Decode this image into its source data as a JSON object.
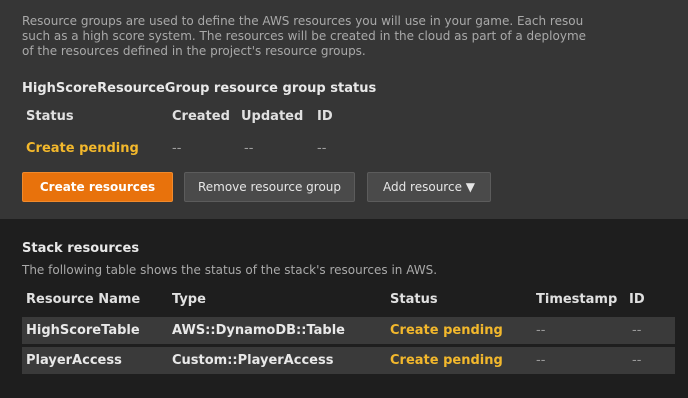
{
  "intro_lines": [
    "Resource groups are used to define the AWS resources you will use in your game. Each resou",
    "such as a high score system. The resources will be created in the cloud as part of a deployme",
    "of the resources defined in the project's resource groups."
  ],
  "group": {
    "title": "HighScoreResourceGroup resource group status",
    "headers": {
      "status": "Status",
      "created": "Created",
      "updated": "Updated",
      "id": "ID"
    },
    "values": {
      "status": "Create pending",
      "created": "--",
      "updated": "--",
      "id": "--"
    }
  },
  "buttons": {
    "create": "Create resources",
    "remove": "Remove resource group",
    "add": "Add resource ▼"
  },
  "stack": {
    "title": "Stack resources",
    "description": "The following table shows the status of the stack's resources in AWS.",
    "headers": {
      "name": "Resource Name",
      "type": "Type",
      "status": "Status",
      "timestamp": "Timestamp",
      "id": "ID"
    },
    "rows": [
      {
        "name": "HighScoreTable",
        "type": "AWS::DynamoDB::Table",
        "status": "Create pending",
        "timestamp": "--",
        "id": "--"
      },
      {
        "name": "PlayerAccess",
        "type": "Custom::PlayerAccess",
        "status": "Create pending",
        "timestamp": "--",
        "id": "--"
      }
    ]
  },
  "colors": {
    "accent": "#e8720c",
    "pending": "#f3b82c",
    "panel_bg": "#363636",
    "lower_bg": "#1e1e1e"
  }
}
